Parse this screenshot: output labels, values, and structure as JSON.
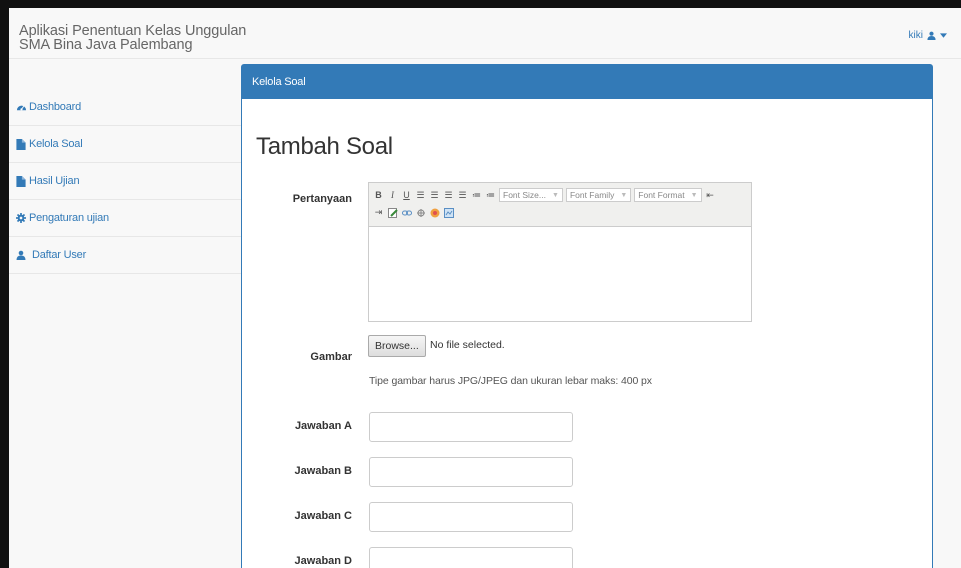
{
  "app": {
    "title_line1": "Aplikasi Penentuan Kelas Unggulan",
    "title_line2": "SMA Bina Java Palembang"
  },
  "user_menu": {
    "username": "kiki",
    "icon": "user-icon",
    "caret": "caret-down-icon"
  },
  "sidebar": {
    "items": [
      {
        "label": "Dashboard",
        "icon": "dashboard-icon"
      },
      {
        "label": "Kelola Soal",
        "icon": "file-icon"
      },
      {
        "label": "Hasil Ujian",
        "icon": "file-icon"
      },
      {
        "label": "Pengaturan ujian",
        "icon": "gear-icon"
      },
      {
        "label": "Daftar User",
        "icon": "user-icon"
      }
    ]
  },
  "panel": {
    "heading": "Kelola Soal"
  },
  "form": {
    "title": "Tambah Soal",
    "pertanyaan_label": "Pertanyaan",
    "editor_toolbar": {
      "buttons_row1": [
        "bold-icon",
        "italic-icon",
        "underline-icon",
        "align-left-icon",
        "align-center-icon",
        "align-right-icon",
        "align-justify-icon",
        "unordered-list-icon",
        "ordered-list-icon"
      ],
      "font_size": "Font Size...",
      "font_family": "Font Family",
      "font_format": "Font Format",
      "buttons_row2": [
        "outdent-icon",
        "indent-icon",
        "edit-icon",
        "link-icon",
        "unlink-icon",
        "image-icon",
        "code-icon"
      ]
    },
    "gambar_label": "Gambar",
    "browse_label": "Browse...",
    "file_status": "No file selected.",
    "gambar_help": "Tipe gambar harus JPG/JPEG dan ukuran lebar maks: 400 px",
    "answers": [
      {
        "label": "Jawaban A",
        "value": ""
      },
      {
        "label": "Jawaban B",
        "value": ""
      },
      {
        "label": "Jawaban C",
        "value": ""
      },
      {
        "label": "Jawaban D",
        "value": ""
      }
    ]
  },
  "colors": {
    "primary": "#337ab7",
    "navbar_bg": "#f8f8f8",
    "border": "#e7e7e7"
  }
}
